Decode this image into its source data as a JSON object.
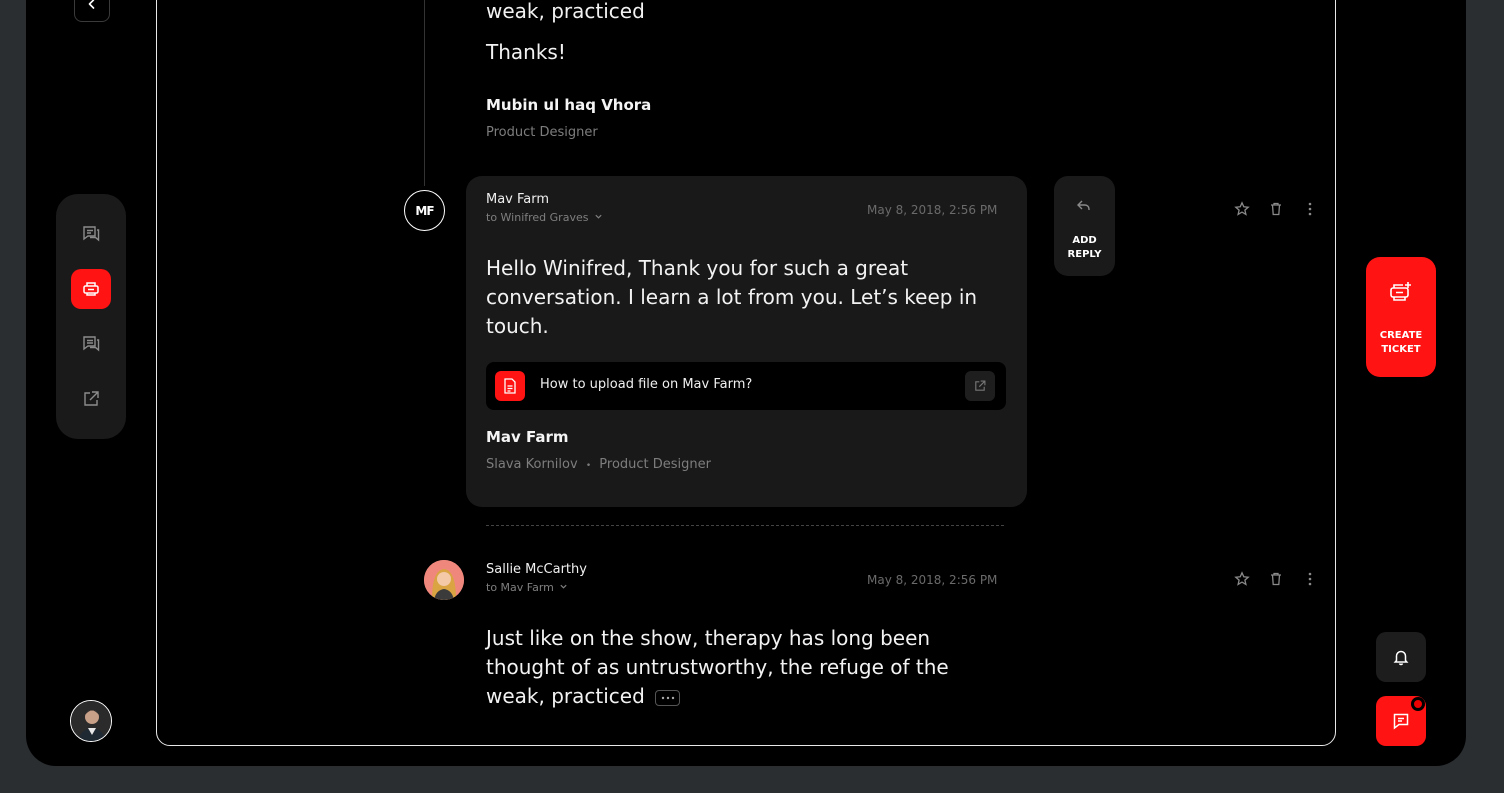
{
  "colors": {
    "accent": "#ff1313",
    "background": "#000000",
    "card": "#191919",
    "muted": "#7d7d7d"
  },
  "sidebar": {
    "items": [
      {
        "icon": "conversations-icon",
        "active": false
      },
      {
        "icon": "ticket-icon",
        "active": true
      },
      {
        "icon": "messages-icon",
        "active": false
      },
      {
        "icon": "external-link-icon",
        "active": false
      }
    ]
  },
  "thread": {
    "previous": {
      "tail_text": "weak, practiced",
      "thanks": "Thanks!",
      "signature_name": "Mubin ul haq Vhora",
      "signature_role": "Product Designer"
    },
    "mav_message": {
      "avatar_initials": "MF",
      "sender": "Mav Farm",
      "to": "to Winifred Graves",
      "date": "May 8, 2018, 2:56 PM",
      "body_line1": "Hello Winifred, Thank you for such a great",
      "body_line2": "conversation. I learn a lot from you. Let’s keep in",
      "body_line3": "touch.",
      "attachment_title": "How to upload file on Mav Farm?",
      "signature_name": "Mav Farm",
      "signature_person": "Slava Kornilov",
      "signature_separator": "•",
      "signature_role": "Product Designer"
    },
    "add_reply_label": "ADD\nREPLY",
    "sallie_message": {
      "sender": "Sallie McCarthy",
      "to": "to Mav Farm",
      "date": "May 8, 2018, 2:56 PM",
      "body_line1": "Just like on the show, therapy has long been",
      "body_line2": "thought of as untrustworthy, the refuge of the",
      "body_line3": "weak, practiced"
    }
  },
  "create_ticket_label": "CREATE\nTICKET"
}
